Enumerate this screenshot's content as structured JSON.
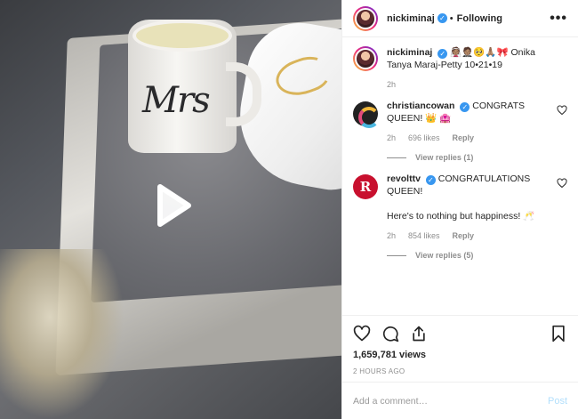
{
  "media": {
    "mug_text": "Mrs"
  },
  "header": {
    "username": "nickiminaj",
    "verified_mark": "✓",
    "separator": "•",
    "follow_status": "Following",
    "more_glyph": "•••"
  },
  "caption": {
    "username": "nickiminaj",
    "verified_mark": "✓",
    "text": "👰🏽🤵🏽🥺🙏🏽🎀 Onika Tanya Maraj-Petty 10•21•19",
    "age": "2h"
  },
  "comments": [
    {
      "username": "christiancowan",
      "verified_mark": "✓",
      "text": "CONGRATS QUEEN! 👑 🏩",
      "extra": "",
      "age": "2h",
      "likes": "696 likes",
      "reply_label": "Reply",
      "view_replies": "View replies (1)"
    },
    {
      "username": "revolttv",
      "verified_mark": "✓",
      "avatar_letter": "R",
      "text": "CONGRATULATIONS QUEEN!",
      "extra": "Here's to nothing but happiness! 🥂",
      "age": "2h",
      "likes": "854 likes",
      "reply_label": "Reply",
      "view_replies": "View replies (5)"
    }
  ],
  "stats": {
    "views": "1,659,781 views",
    "time": "2 HOURS AGO"
  },
  "add_comment": {
    "placeholder": "Add a comment…",
    "post_label": "Post"
  },
  "icons": {
    "like": "heart-icon",
    "comment": "comment-icon",
    "share": "share-icon",
    "save": "bookmark-icon",
    "play": "play-icon"
  },
  "colors": {
    "verified": "#3897f0",
    "post_disabled": "#b2dffc",
    "revolt_brand": "#c8102e"
  }
}
